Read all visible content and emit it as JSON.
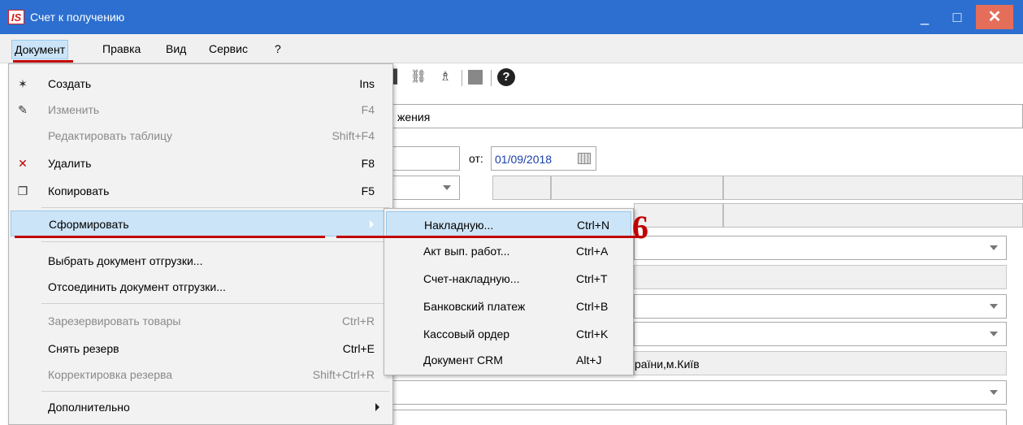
{
  "window": {
    "logo": "IS",
    "title": "Счет к получению",
    "minimize": "_",
    "maximize": "□",
    "close": "✕"
  },
  "menubar": [
    "Документ",
    "Правка",
    "Вид",
    "Сервис",
    "?"
  ],
  "background": {
    "field_partial_text": "жения",
    "date_label": "от:",
    "date_value": "01/09/2018",
    "address_partial": "раїни,м.Київ"
  },
  "dropdown": {
    "items": [
      {
        "label": "Создать",
        "shortcut": "Ins",
        "icon": "new-doc-icon",
        "enabled": true
      },
      {
        "label": "Изменить",
        "shortcut": "F4",
        "icon": "edit-doc-icon",
        "enabled": false
      },
      {
        "label": "Редактировать таблицу",
        "shortcut": "Shift+F4",
        "enabled": false
      },
      {
        "label": "Удалить",
        "shortcut": "F8",
        "icon": "delete-doc-icon",
        "enabled": true
      },
      {
        "label": "Копировать",
        "shortcut": "F5",
        "icon": "copy-icon",
        "enabled": true
      },
      {
        "label": "Сформировать",
        "submenu": true,
        "highlighted": true
      },
      {
        "label": "Выбрать документ отгрузки...",
        "enabled": true
      },
      {
        "label": "Отсоединить документ отгрузки...",
        "enabled": true
      },
      {
        "label": "Зарезервировать товары",
        "shortcut": "Ctrl+R",
        "enabled": false
      },
      {
        "label": "Снять резерв",
        "shortcut": "Ctrl+E",
        "enabled": true
      },
      {
        "label": "Корректировка резерва",
        "shortcut": "Shift+Ctrl+R",
        "enabled": false
      },
      {
        "label": "Дополнительно",
        "submenu": true
      }
    ]
  },
  "submenu": {
    "items": [
      {
        "label": "Накладную...",
        "shortcut": "Ctrl+N",
        "highlighted": true
      },
      {
        "label": "Акт вып. работ...",
        "shortcut": "Ctrl+A"
      },
      {
        "label": "Счет-накладную...",
        "shortcut": "Ctrl+T"
      },
      {
        "label": "Банковский платеж",
        "shortcut": "Ctrl+B"
      },
      {
        "label": "Кассовый ордер",
        "shortcut": "Ctrl+K"
      },
      {
        "label": "Документ CRM",
        "shortcut": "Alt+J"
      }
    ]
  },
  "annotation": {
    "step": "6"
  },
  "colors": {
    "titlebar": "#2c6fd0",
    "highlight": "#cce4f7",
    "annotation": "#c00000",
    "close": "#e56e5a"
  }
}
